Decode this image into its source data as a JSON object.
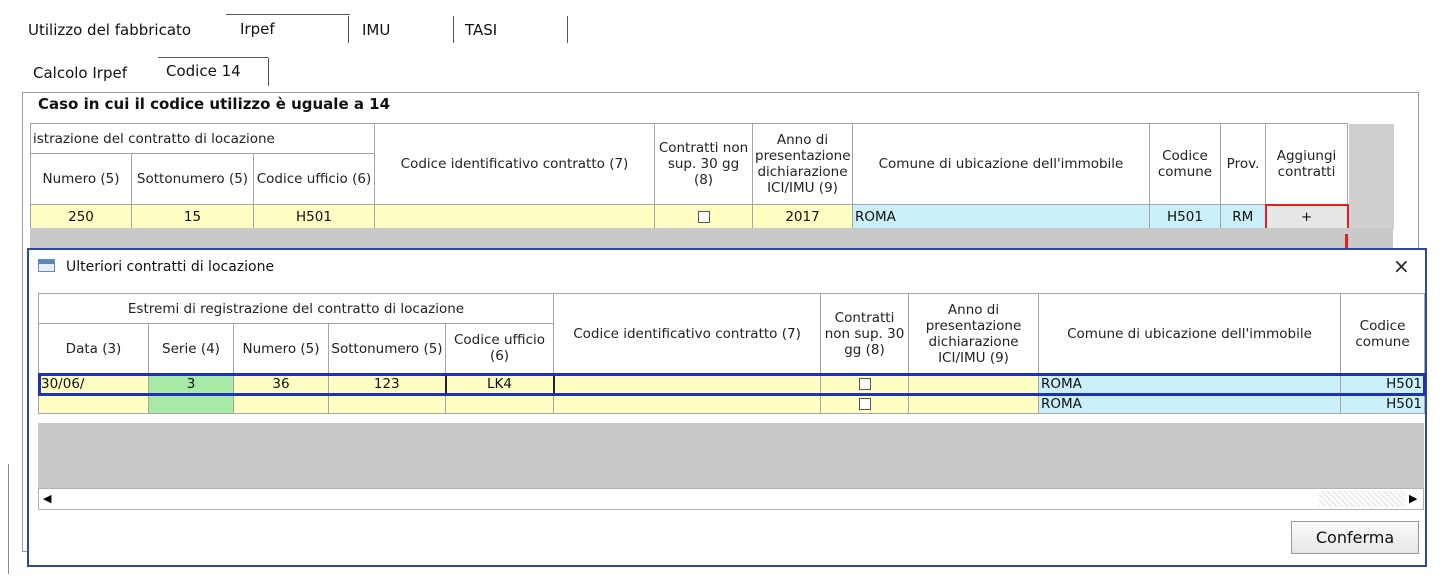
{
  "top_tabs": {
    "label": "Utilizzo del fabbricato",
    "items": [
      "Irpef",
      "IMU",
      "TASI"
    ]
  },
  "sub_tabs": [
    "Calcolo Irpef",
    "Codice 14"
  ],
  "panel": {
    "legend": "Caso in cui il codice utilizzo è uguale a 14"
  },
  "main_table": {
    "group_header": "istrazione del contratto di locazione",
    "headers": {
      "numero": "Numero (5)",
      "sottonumero": "Sottonumero (5)",
      "codice_ufficio": "Codice ufficio (6)",
      "codice_id": "Codice identificativo contratto (7)",
      "contratti": "Contratti non sup. 30 gg (8)",
      "anno": "Anno di presentazione dichiarazione ICI/IMU (9)",
      "comune": "Comune di ubicazione dell'immobile",
      "codice_comune": "Codice comune",
      "prov": "Prov.",
      "aggiungi": "Aggiungi contratti"
    },
    "row": {
      "numero": "250",
      "sottonumero": "15",
      "codice_ufficio": "H501",
      "anno": "2017",
      "comune": "ROMA",
      "codice_comune": "H501",
      "prov": "RM",
      "aggiungi": "+"
    }
  },
  "dialog": {
    "title": "Ulteriori contratti di locazione",
    "close": "×",
    "group_header": "Estremi di registrazione del contratto di locazione",
    "headers": {
      "data": "Data (3)",
      "serie": "Serie (4)",
      "numero": "Numero (5)",
      "sottonumero": "Sottonumero (5)",
      "codice_ufficio": "Codice ufficio (6)",
      "codice_id": "Codice identificativo contratto (7)",
      "contratti": "Contratti non sup. 30 gg (8)",
      "anno": "Anno di presentazione dichiarazione ICI/IMU (9)",
      "comune": "Comune di ubicazione dell'immobile",
      "codice_comune": "Codice comune"
    },
    "rows": [
      {
        "data": "30/06/",
        "serie": "3",
        "numero": "36",
        "sottonumero": "123",
        "codice_ufficio": "LK4",
        "comune": "ROMA",
        "codice_comune": "H501"
      },
      {
        "data": "",
        "serie": "",
        "numero": "",
        "sottonumero": "",
        "codice_ufficio": "",
        "comune": "ROMA",
        "codice_comune": "H501"
      }
    ],
    "confirm": "Conferma"
  },
  "colors": {
    "yellow": "#ffffc4",
    "green": "#a6eaa6",
    "blue": "#c9f0fb",
    "highlight": "#1f31b8",
    "red": "#e02020"
  }
}
